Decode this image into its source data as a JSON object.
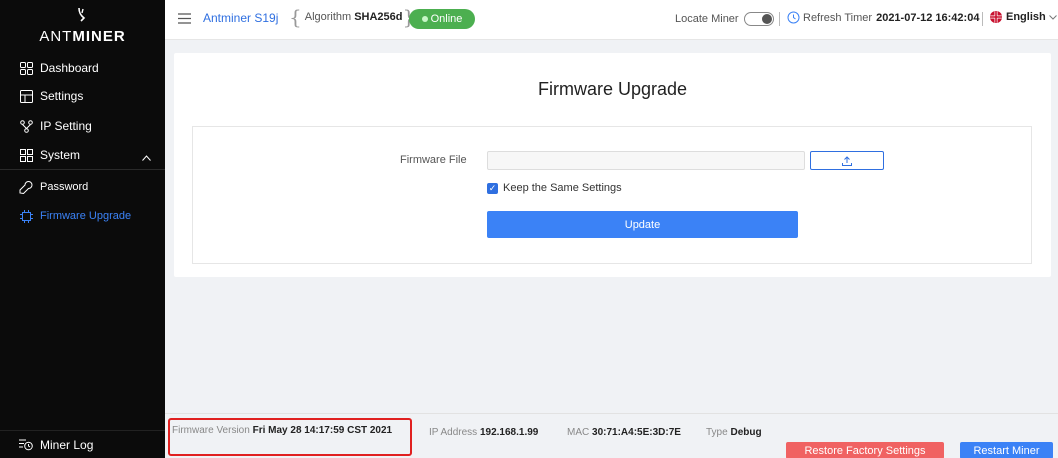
{
  "brand": {
    "logo_prefix": "ANT",
    "logo_suffix": "MINER"
  },
  "sidebar": {
    "items": [
      {
        "label": "Dashboard",
        "icon": "dashboard-icon"
      },
      {
        "label": "Settings",
        "icon": "settings-icon"
      },
      {
        "label": "IP Setting",
        "icon": "network-icon"
      },
      {
        "label": "System",
        "icon": "system-icon",
        "expanded": true
      },
      {
        "label": "Password",
        "icon": "key-icon"
      },
      {
        "label": "Firmware Upgrade",
        "icon": "chip-icon",
        "active": true
      }
    ],
    "miner_log": "Miner Log"
  },
  "header": {
    "model": "Antminer S19j",
    "algorithm_label": "Algorithm",
    "algorithm_value": "SHA256d",
    "status": "Online",
    "locate_label": "Locate Miner",
    "refresh_label": "Refresh Timer",
    "refresh_value": "2021-07-12 16:42:04",
    "language": "English"
  },
  "main": {
    "title": "Firmware Upgrade",
    "firmware_file_label": "Firmware File",
    "firmware_file_value": "",
    "keep_settings_label": "Keep the Same Settings",
    "keep_settings_checked": true,
    "update_label": "Update"
  },
  "footer": {
    "fw_version_label": "Firmware Version",
    "fw_version_value": "Fri May 28 14:17:59 CST 2021",
    "ip_label": "IP Address",
    "ip_value": "192.168.1.99",
    "mac_label": "MAC",
    "mac_value": "30:71:A4:5E:3D:7E",
    "type_label": "Type",
    "type_value": "Debug",
    "restore_label": "Restore Factory Settings",
    "restart_label": "Restart Miner"
  },
  "colors": {
    "accent": "#3b82f6",
    "online": "#4caf50",
    "danger": "#f06262",
    "highlight": "#e02020"
  }
}
